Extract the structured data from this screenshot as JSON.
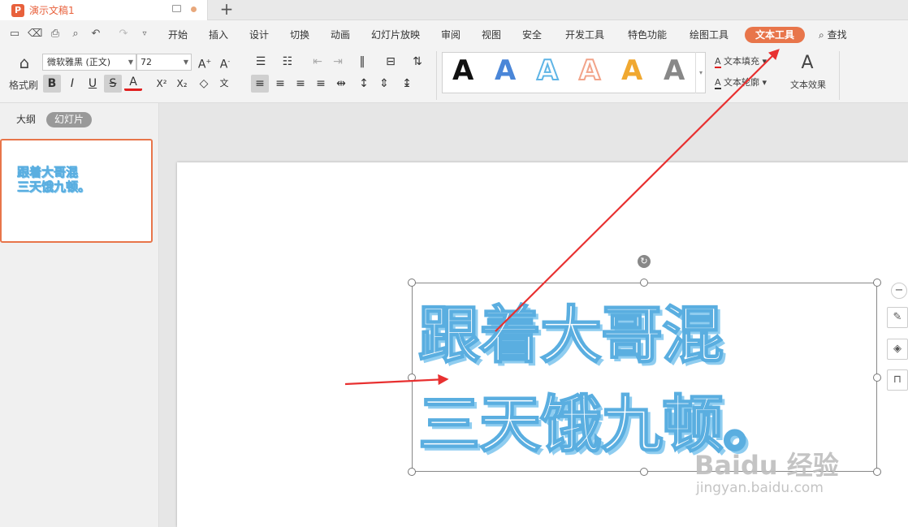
{
  "title_bar": {
    "doc_logo": "P",
    "doc_title": "演示文稿1",
    "new_tab": "+"
  },
  "menu": {
    "items": [
      "开始",
      "插入",
      "设计",
      "切换",
      "动画",
      "幻灯片放映",
      "审阅",
      "视图",
      "安全",
      "开发工具",
      "特色功能",
      "绘图工具"
    ],
    "active": "文本工具",
    "search": "查找"
  },
  "ribbon": {
    "format_painter": "格式刷",
    "font_name": "微软雅黑 (正文)",
    "font_size": "72",
    "text_fill": "文本填充",
    "text_outline": "文本轮廓",
    "text_effects": "文本效果",
    "gallery_letter": "A",
    "gallery_colors": [
      "#111111",
      "#4a86d8",
      "#5fb5e6",
      "#f2a48a",
      "#f0a830",
      "#888888"
    ]
  },
  "left_panel": {
    "tab_outline": "大纲",
    "tab_slides": "幻灯片",
    "thumb_line1": "跟着大哥混",
    "thumb_line2": "三天饿九顿。"
  },
  "slide": {
    "line1": "跟着大哥混",
    "line2": "三天饿九顿。"
  },
  "watermark": {
    "main": "Baidu 经验",
    "sub": "jingyan.baidu.com"
  },
  "colors": {
    "accent": "#e8754a",
    "text_outline": "#5aaee0",
    "arrow": "#e83030"
  }
}
